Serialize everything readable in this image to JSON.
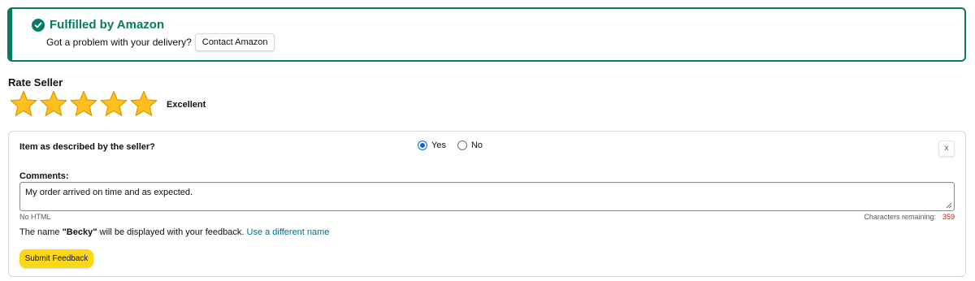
{
  "fulfilled": {
    "title": "Fulfilled by Amazon",
    "problem_text": "Got a problem with your delivery?",
    "contact_label": "Contact Amazon"
  },
  "rating": {
    "title": "Rate Seller",
    "stars_selected": 5,
    "stars_total": 5,
    "label": "Excellent"
  },
  "feedback": {
    "question": "Item as described by the seller?",
    "options": [
      {
        "label": "Yes",
        "checked": true
      },
      {
        "label": "No",
        "checked": false
      }
    ],
    "close_label": "x",
    "comments_label": "Comments:",
    "comments_value": "My order arrived on time and as expected.",
    "no_html": "No HTML",
    "chars_label": "Characters remaining:",
    "chars_count": "359",
    "name_prefix": "The name",
    "name": "\"Becky\"",
    "name_suffix": "will be displayed with your feedback.",
    "different_name_link": "Use a different name",
    "submit_label": "Submit Feedback"
  },
  "colors": {
    "accent_green": "#067d62",
    "star_gold": "#ffbf1f",
    "link": "#007185",
    "button_yellow": "#ffd814",
    "radio_blue": "#0a66d8",
    "count_red": "#b12704"
  }
}
